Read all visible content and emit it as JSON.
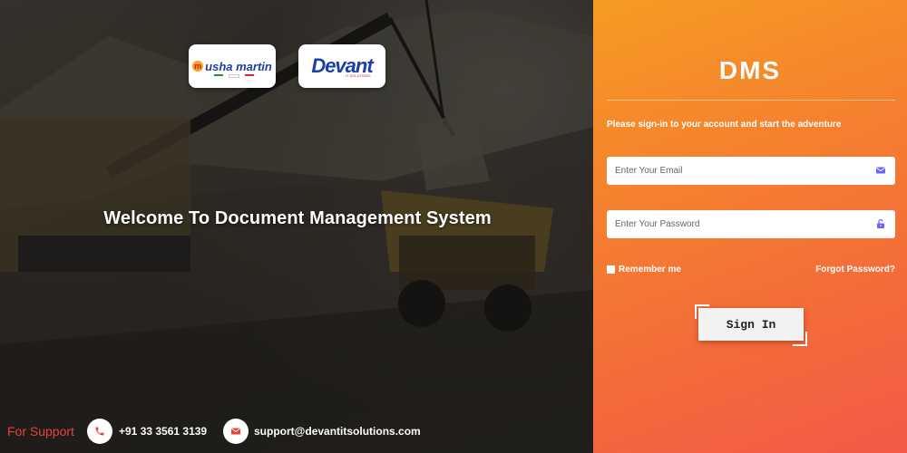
{
  "hero": {
    "welcome_text": "Welcome To Document Management System",
    "logos": {
      "usha_martin": "usha martin",
      "devant": "Devant",
      "devant_sub": "IT SOLUTIONS"
    },
    "support": {
      "label": "For Support",
      "phone": "+91 33 3561 3139",
      "email": "support@devantitsolutions.com",
      "phone_icon": "phone-icon",
      "email_icon": "envelope-icon"
    }
  },
  "login": {
    "brand": "DMS",
    "subtitle": "Please sign-in to your account and start the adventure",
    "email_placeholder": "Enter Your Email",
    "email_value": "",
    "email_icon": "envelope-icon",
    "password_placeholder": "Enter Your Password",
    "password_value": "",
    "password_icon": "unlock-icon",
    "remember_label": "Remember me",
    "forgot_label": "Forgot Password?",
    "signin_label": "Sign In"
  },
  "colors": {
    "panel_top": "#f69b22",
    "panel_bottom": "#f25a47",
    "support_label": "#e64338",
    "icon_accent": "#6c63ff",
    "icon_red": "#e64338"
  }
}
